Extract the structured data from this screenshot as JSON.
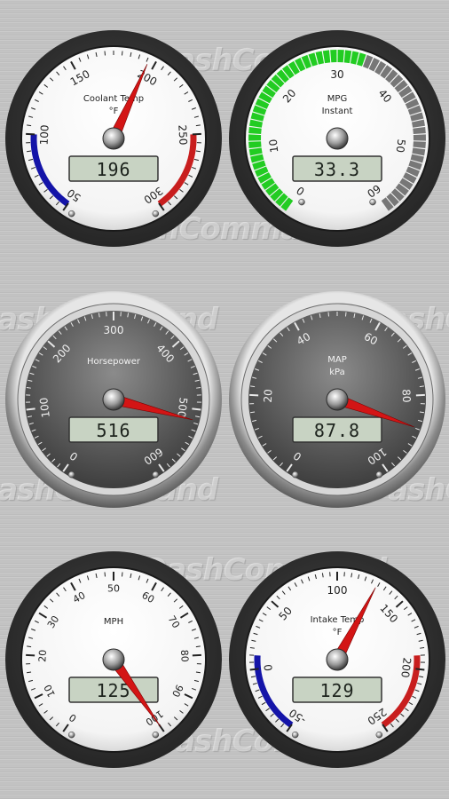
{
  "watermark": "DashCommand",
  "gauges": [
    {
      "id": "coolant",
      "style": "white",
      "title": "Coolant Temp",
      "subtitle": "°F",
      "display": "196",
      "ticks": [
        "50",
        "100",
        "150",
        "200",
        "250",
        "300"
      ],
      "range": [
        50,
        300
      ],
      "value": 196,
      "arc_colors": {
        "low": "#1414a8",
        "high": "#c81e1e"
      }
    },
    {
      "id": "mpg",
      "style": "white-bar",
      "title": "MPG",
      "subtitle": "Instant",
      "display": "33.3",
      "ticks": [
        "0",
        "10",
        "20",
        "30",
        "40",
        "50",
        "60"
      ],
      "range": [
        0,
        60
      ],
      "value": 33.3,
      "bar_colors": {
        "filled": "#22cc22",
        "empty": "#777777"
      }
    },
    {
      "id": "horsepower",
      "style": "dark",
      "title": "Horsepower",
      "subtitle": "",
      "display": "516",
      "ticks": [
        "0",
        "100",
        "200",
        "300",
        "400",
        "500",
        "600"
      ],
      "range": [
        0,
        600
      ],
      "value": 516
    },
    {
      "id": "map",
      "style": "dark",
      "title": "MAP",
      "subtitle": "kPa",
      "display": "87.8",
      "ticks": [
        "0",
        "20",
        "40",
        "60",
        "80",
        "100"
      ],
      "range": [
        0,
        100
      ],
      "value": 87.8
    },
    {
      "id": "mph",
      "style": "white",
      "title": "MPH",
      "subtitle": "",
      "display": "125",
      "ticks": [
        "0",
        "10",
        "20",
        "30",
        "40",
        "50",
        "60",
        "70",
        "80",
        "90",
        "100"
      ],
      "range": [
        0,
        100
      ],
      "value": 125
    },
    {
      "id": "intake",
      "style": "white",
      "title": "Intake Temp",
      "subtitle": "°F",
      "display": "129",
      "ticks": [
        "-50",
        "0",
        "50",
        "100",
        "150",
        "200",
        "250"
      ],
      "range": [
        -50,
        250
      ],
      "value": 129,
      "arc_colors": {
        "low": "#1414a8",
        "high": "#c81e1e"
      }
    }
  ]
}
